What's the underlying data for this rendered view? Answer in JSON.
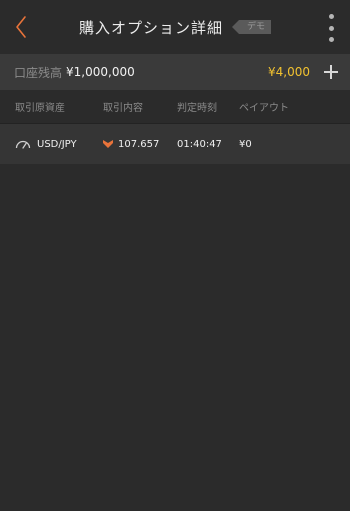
{
  "header": {
    "title": "購入オプション詳細",
    "demo_badge": "デモ",
    "back_icon": "chevron-left-icon",
    "menu_icon": "more-vertical-icon"
  },
  "balance": {
    "label": "口座残高",
    "value": "¥1,000,000",
    "bonus": "¥4,000",
    "add_icon": "plus-icon"
  },
  "table": {
    "columns": [
      "取引原資産",
      "取引内容",
      "判定時刻",
      "ペイアウト"
    ],
    "rows": [
      {
        "asset": "USD/JPY",
        "asset_icon": "gauge-icon",
        "direction_icon": "low-arrow-icon",
        "price": "107.657",
        "time": "01:40:47",
        "payout": "¥0"
      }
    ]
  },
  "colors": {
    "background": "#2b2b2b",
    "accent_orange": "#e8733a",
    "bonus_yellow": "#f2c230",
    "bar_gray": "#3a3a3a"
  }
}
